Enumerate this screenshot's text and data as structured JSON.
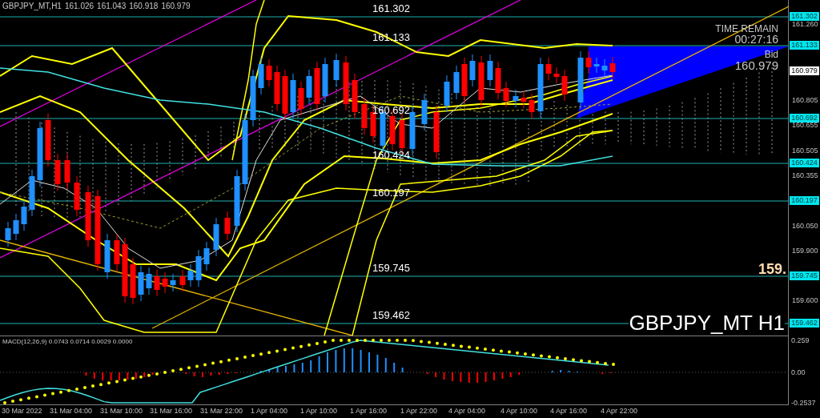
{
  "header": {
    "symbol": "GBPJPY_MT,H1",
    "ohlc": [
      "161.026",
      "161.043",
      "160.918",
      "160.979"
    ]
  },
  "level_labels": [
    "161.302",
    "161.133",
    "160.692",
    "160.424",
    "160.197",
    "159.745",
    "159.462"
  ],
  "timer": {
    "label": "TIME REMAIN",
    "value": "00:27:16"
  },
  "bid": {
    "label": "Bid",
    "value": "160.979"
  },
  "price_mark": "159.",
  "symbol_label": "GBPJPY_MT H1",
  "price_axis": {
    "ticks": [
      "161.260",
      "160.805",
      "160.655",
      "160.505",
      "160.355",
      "160.050",
      "159.900",
      "159.600"
    ],
    "tags": [
      {
        "text": "161.302",
        "kind": "level"
      },
      {
        "text": "161.133",
        "kind": "level"
      },
      {
        "text": "160.979",
        "kind": "bid"
      },
      {
        "text": "160.692",
        "kind": "level"
      },
      {
        "text": "160.424",
        "kind": "level"
      },
      {
        "text": "160.197",
        "kind": "level"
      },
      {
        "text": "159.745",
        "kind": "level"
      },
      {
        "text": "159.462",
        "kind": "level"
      }
    ]
  },
  "macd": {
    "label": "MACD(12,26,9) 0.0743 0.0714 0.0029 0.0000",
    "ticks": [
      "0.259",
      "0.00",
      "-0.2537"
    ]
  },
  "time_axis": [
    "30 Mar 2022",
    "31 Mar 04:00",
    "31 Mar 10:00",
    "31 Mar 16:00",
    "31 Mar 22:00",
    "1 Apr 04:00",
    "1 Apr 10:00",
    "1 Apr 16:00",
    "1 Apr 22:00",
    "4 Apr 04:00",
    "4 Apr 10:00",
    "4 Apr 16:00",
    "4 Apr 22:00"
  ]
}
